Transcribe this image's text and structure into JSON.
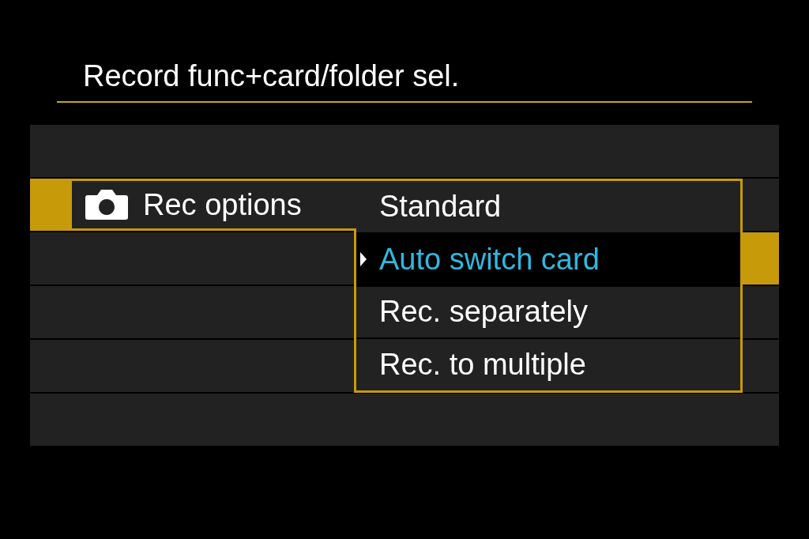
{
  "title": "Record func+card/folder sel.",
  "menu_item": {
    "label": "Rec options",
    "selected": true
  },
  "options": [
    {
      "label": "Standard",
      "selected": false
    },
    {
      "label": "Auto switch card",
      "selected": true
    },
    {
      "label": "Rec. separately",
      "selected": false
    },
    {
      "label": "Rec. to multiple",
      "selected": false
    }
  ]
}
